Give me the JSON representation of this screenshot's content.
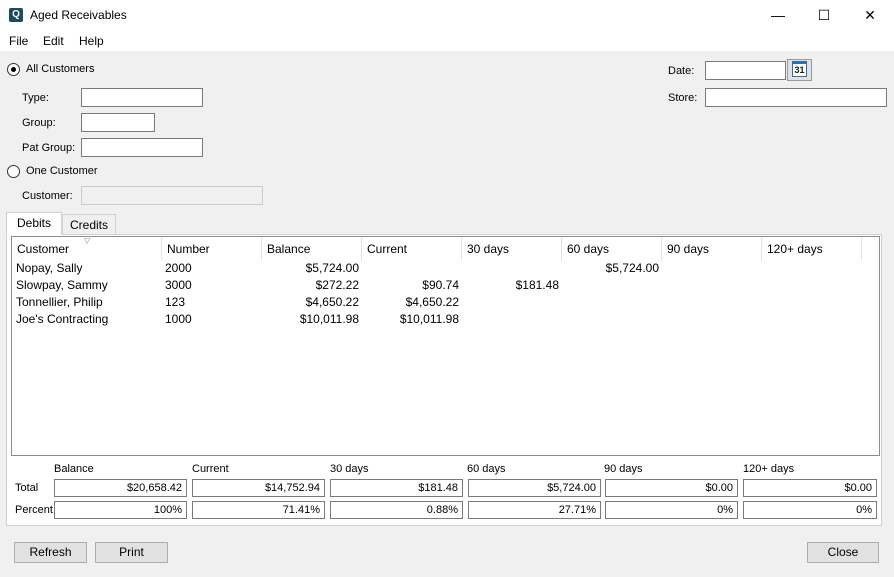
{
  "window": {
    "title": "Aged Receivables",
    "minimize": "—",
    "maximize": "☐",
    "close": "✕"
  },
  "menu": [
    "File",
    "Edit",
    "Help"
  ],
  "filters": {
    "all_customers": "All Customers",
    "type_label": "Type:",
    "group_label": "Group:",
    "pat_group_label": "Pat Group:",
    "one_customer": "One Customer",
    "customer_label": "Customer:",
    "date_label": "Date:",
    "store_label": "Store:",
    "calendar_day": "31"
  },
  "tabs": [
    "Debits",
    "Credits"
  ],
  "grid": {
    "columns": [
      "Customer",
      "Number",
      "Balance",
      "Current",
      "30 days",
      "60 days",
      "90 days",
      "120+ days"
    ],
    "rows": [
      [
        "Nopay, Sally",
        "2000",
        "$5,724.00",
        "",
        "",
        "$5,724.00",
        "",
        ""
      ],
      [
        "Slowpay, Sammy",
        "3000",
        "$272.22",
        "$90.74",
        "$181.48",
        "",
        "",
        ""
      ],
      [
        "Tonnellier, Philip",
        "123",
        "$4,650.22",
        "$4,650.22",
        "",
        "",
        "",
        ""
      ],
      [
        "Joe's Contracting",
        "1000",
        "$10,011.98",
        "$10,011.98",
        "",
        "",
        "",
        ""
      ]
    ]
  },
  "summary": {
    "headers": [
      "Balance",
      "Current",
      "30 days",
      "60 days",
      "90 days",
      "120+ days"
    ],
    "total_label": "Total",
    "percent_label": "Percent",
    "totals": [
      "$20,658.42",
      "$14,752.94",
      "$181.48",
      "$5,724.00",
      "$0.00",
      "$0.00"
    ],
    "percents": [
      "100%",
      "71.41%",
      "0.88%",
      "27.71%",
      "0%",
      "0%"
    ]
  },
  "buttons": {
    "refresh": "Refresh",
    "print": "Print",
    "close": "Close"
  }
}
